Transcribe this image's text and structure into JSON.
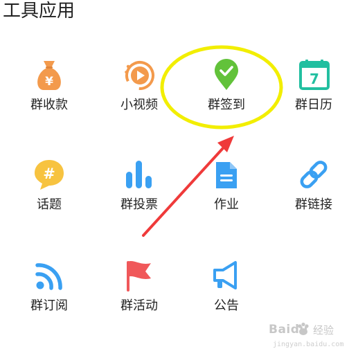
{
  "section": {
    "title": "工具应用"
  },
  "tools": [
    {
      "label": "群收款",
      "icon": "money-bag-icon"
    },
    {
      "label": "小视频",
      "icon": "video-play-icon"
    },
    {
      "label": "群签到",
      "icon": "check-pin-icon"
    },
    {
      "label": "群日历",
      "icon": "calendar-icon"
    },
    {
      "label": "话题",
      "icon": "hashtag-bubble-icon"
    },
    {
      "label": "群投票",
      "icon": "bar-chart-icon"
    },
    {
      "label": "作业",
      "icon": "document-icon"
    },
    {
      "label": "群链接",
      "icon": "link-icon"
    },
    {
      "label": "群订阅",
      "icon": "rss-icon"
    },
    {
      "label": "群活动",
      "icon": "flag-icon"
    },
    {
      "label": "公告",
      "icon": "megaphone-icon"
    }
  ],
  "calendar_day": "7",
  "currency_symbol": "¥",
  "hash_symbol": "#",
  "colors": {
    "orange": "#f39a4c",
    "blue": "#3aa0f2",
    "green": "#62c23a",
    "teal": "#22bfa0",
    "yellow": "#f7c340",
    "red": "#f0585a",
    "highlight": "#f2ee00",
    "arrow": "#ef3a3a"
  },
  "watermark": {
    "brand": "Baidu",
    "cn": "经验",
    "url": "jingyan.baidu.com"
  }
}
